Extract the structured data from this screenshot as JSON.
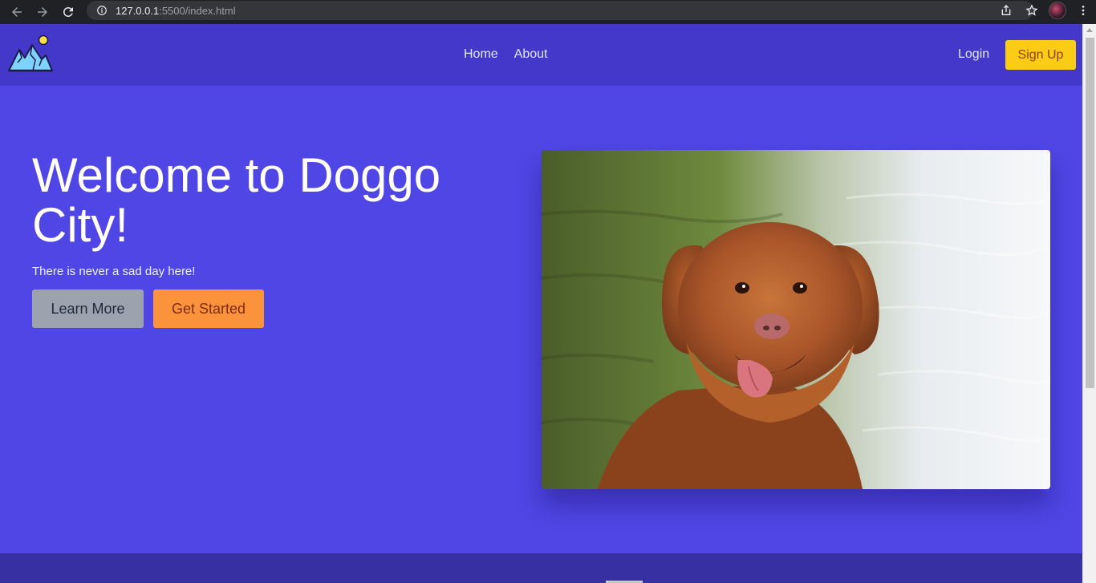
{
  "browser": {
    "url_host": "127.0.0.1",
    "url_rest": ":5500/index.html"
  },
  "nav": {
    "links": [
      "Home",
      "About"
    ],
    "login": "Login",
    "signup": "Sign Up"
  },
  "hero": {
    "title": "Welcome to Doggo City!",
    "subtitle": "There is never a sad day here!",
    "learn_more": "Learn More",
    "get_started": "Get Started"
  },
  "colors": {
    "page_bg": "#4f46e5",
    "nav_bg": "#4338ca",
    "signup_bg": "#facc15",
    "learn_bg": "#9ca3af",
    "start_bg": "#fb923c"
  }
}
